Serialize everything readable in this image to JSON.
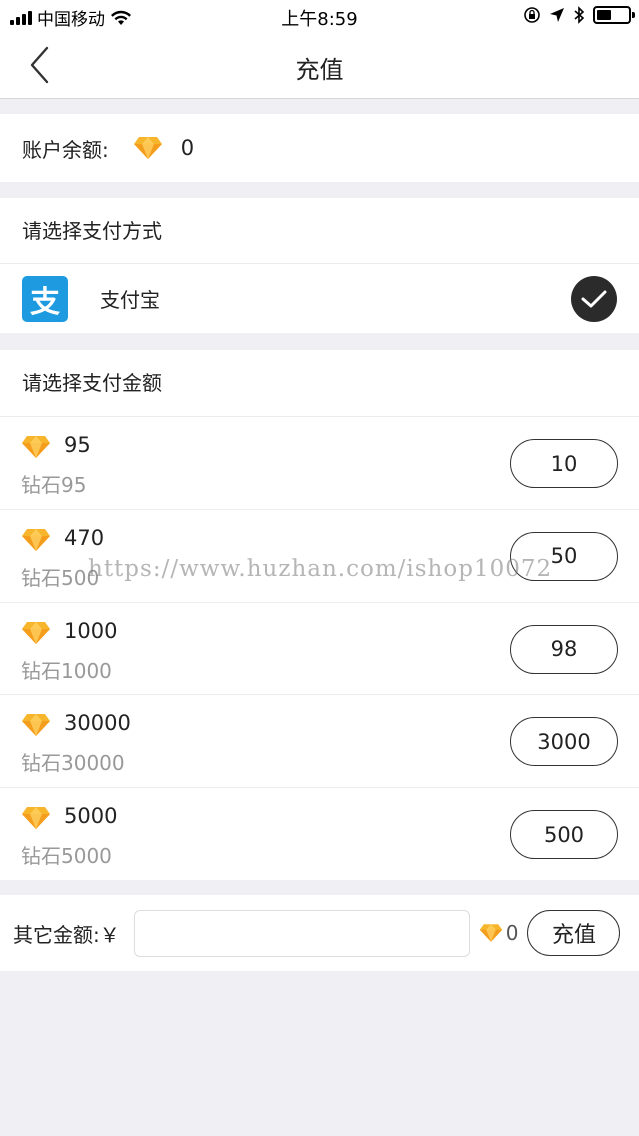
{
  "statusbar": {
    "carrier": "中国移动",
    "time": "上午8:59",
    "icons": [
      "signal-icon",
      "wifi-icon",
      "orientation-lock-icon",
      "location-icon",
      "bluetooth-icon",
      "battery-icon"
    ]
  },
  "header": {
    "title": "充值",
    "back_icon": "back-chevron-icon"
  },
  "balance": {
    "label": "账户余额:",
    "icon": "diamond-icon",
    "value": "0"
  },
  "payment": {
    "heading": "请选择支付方式",
    "method": {
      "logo_char": "支",
      "label": "支付宝",
      "logo_color": "#1e9ae0",
      "selected": true
    }
  },
  "amounts": {
    "heading": "请选择支付金额",
    "items": [
      {
        "diamonds": "95",
        "desc": "钻石95",
        "price": "10"
      },
      {
        "diamonds": "470",
        "desc": "钻石500",
        "price": "50"
      },
      {
        "diamonds": "1000",
        "desc": "钻石1000",
        "price": "98"
      },
      {
        "diamonds": "30000",
        "desc": "钻石30000",
        "price": "3000"
      },
      {
        "diamonds": "5000",
        "desc": "钻石5000",
        "price": "500"
      }
    ]
  },
  "other": {
    "label": "其它金额:￥",
    "input_value": "",
    "diamond_value": "0",
    "button_label": "充值"
  },
  "watermark": "https://www.huzhan.com/ishop10072",
  "colors": {
    "background": "#efeff4",
    "diamond": "#f7b52c",
    "alipay": "#1e9ae0",
    "check": "#2b2b2b"
  }
}
